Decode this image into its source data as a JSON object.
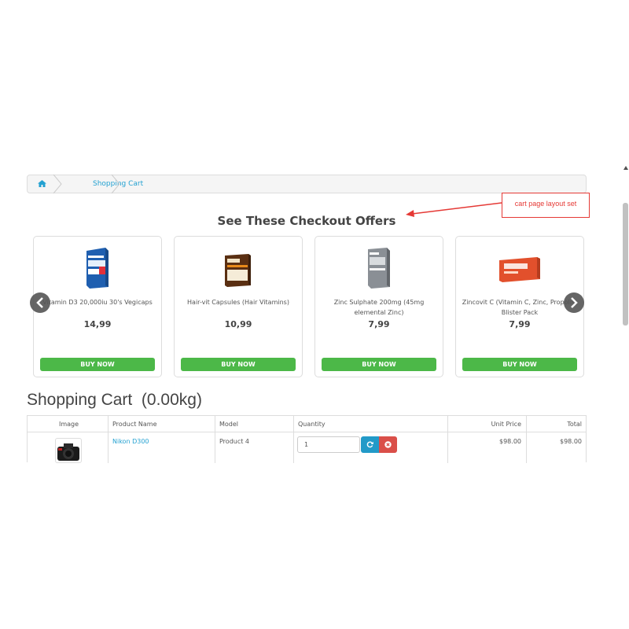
{
  "breadcrumb": {
    "home_icon": "home-icon",
    "current": "Shopping Cart"
  },
  "annotation": {
    "text": "cart page layout set",
    "color": "#e53935"
  },
  "offers": {
    "title": "See These Checkout Offers",
    "buy_label": "BUY NOW",
    "items": [
      {
        "name": "Vitamin D3 20,000iu 30's Vegicaps",
        "price": "14,99"
      },
      {
        "name": "Hair-vit Capsules (Hair Vitamins)",
        "price": "10,99"
      },
      {
        "name": "Zinc Sulphate 200mg (45mg elemental Zinc)",
        "price": "7,99"
      },
      {
        "name": "Zincovit C (Vitamin C, Zinc, Propolis) Blister Pack",
        "price": "7,99"
      }
    ]
  },
  "cart": {
    "title": "Shopping Cart  (0.00kg)",
    "columns": [
      "Image",
      "Product Name",
      "Model",
      "Quantity",
      "Unit Price",
      "Total"
    ],
    "rows": [
      {
        "name": "Nikon D300",
        "model": "Product 4",
        "quantity": "1",
        "unit_price": "$98.00",
        "total": "$98.00"
      }
    ]
  },
  "colors": {
    "link": "#23a1d1",
    "buy": "#4cb848",
    "refresh": "#229ac8",
    "remove": "#da4f49"
  }
}
